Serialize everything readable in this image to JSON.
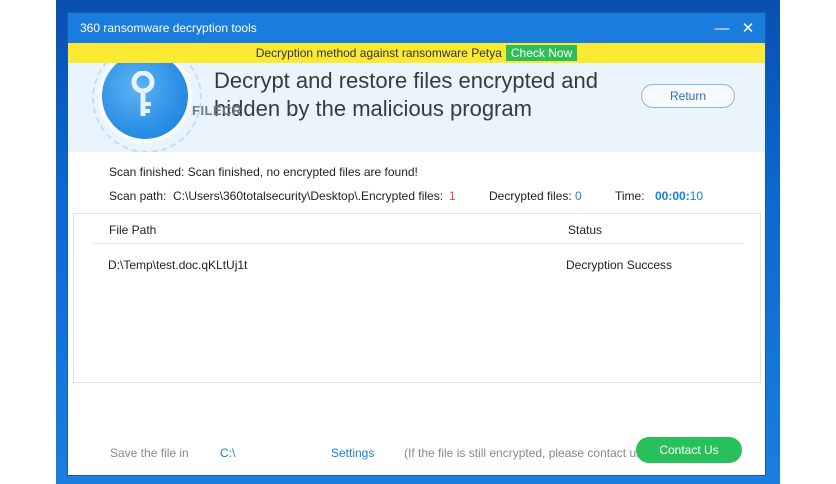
{
  "window": {
    "title": "360 ransomware decryption tools",
    "minimize": "—",
    "close": "✕"
  },
  "banner": {
    "text": "Decryption method against ransomware Petya",
    "check_label": "Check Now"
  },
  "hero": {
    "headline_line1": "Decrypt and restore files encrypted and",
    "headline_line2": "hidden by the malicious program",
    "watermark": "FILECR",
    "return_label": "Return"
  },
  "scan": {
    "finished_label": "Scan finished:",
    "finished_text": "Scan finished, no encrypted files are found!",
    "path_label": "Scan path:",
    "path_value": "C:\\Users\\360totalsecurity\\Desktop\\...",
    "encrypted_label": "Encrypted files:",
    "encrypted_value": "1",
    "decrypted_label": "Decrypted files:",
    "decrypted_value": "0",
    "time_label": "Time:",
    "time_value_prefix": "00:00:",
    "time_value_suffix": "10"
  },
  "table": {
    "columns": [
      "File Path",
      "Status"
    ],
    "rows": [
      {
        "path": "D:\\Temp\\test.doc.qKLtUj1t",
        "status": "Decryption Success"
      }
    ]
  },
  "footer": {
    "save_label": "Save the file in",
    "save_path": "C:\\",
    "settings_label": "Settings",
    "note": "(If the file is still encrypted, please contact us.)",
    "contact_label": "Contact Us"
  },
  "colors": {
    "titlebar": "#1a7dde",
    "banner": "#fbe934",
    "accent_green": "#27c05a",
    "encrypted_red": "#e84b2a"
  },
  "icons": {
    "hero": "key-icon"
  }
}
